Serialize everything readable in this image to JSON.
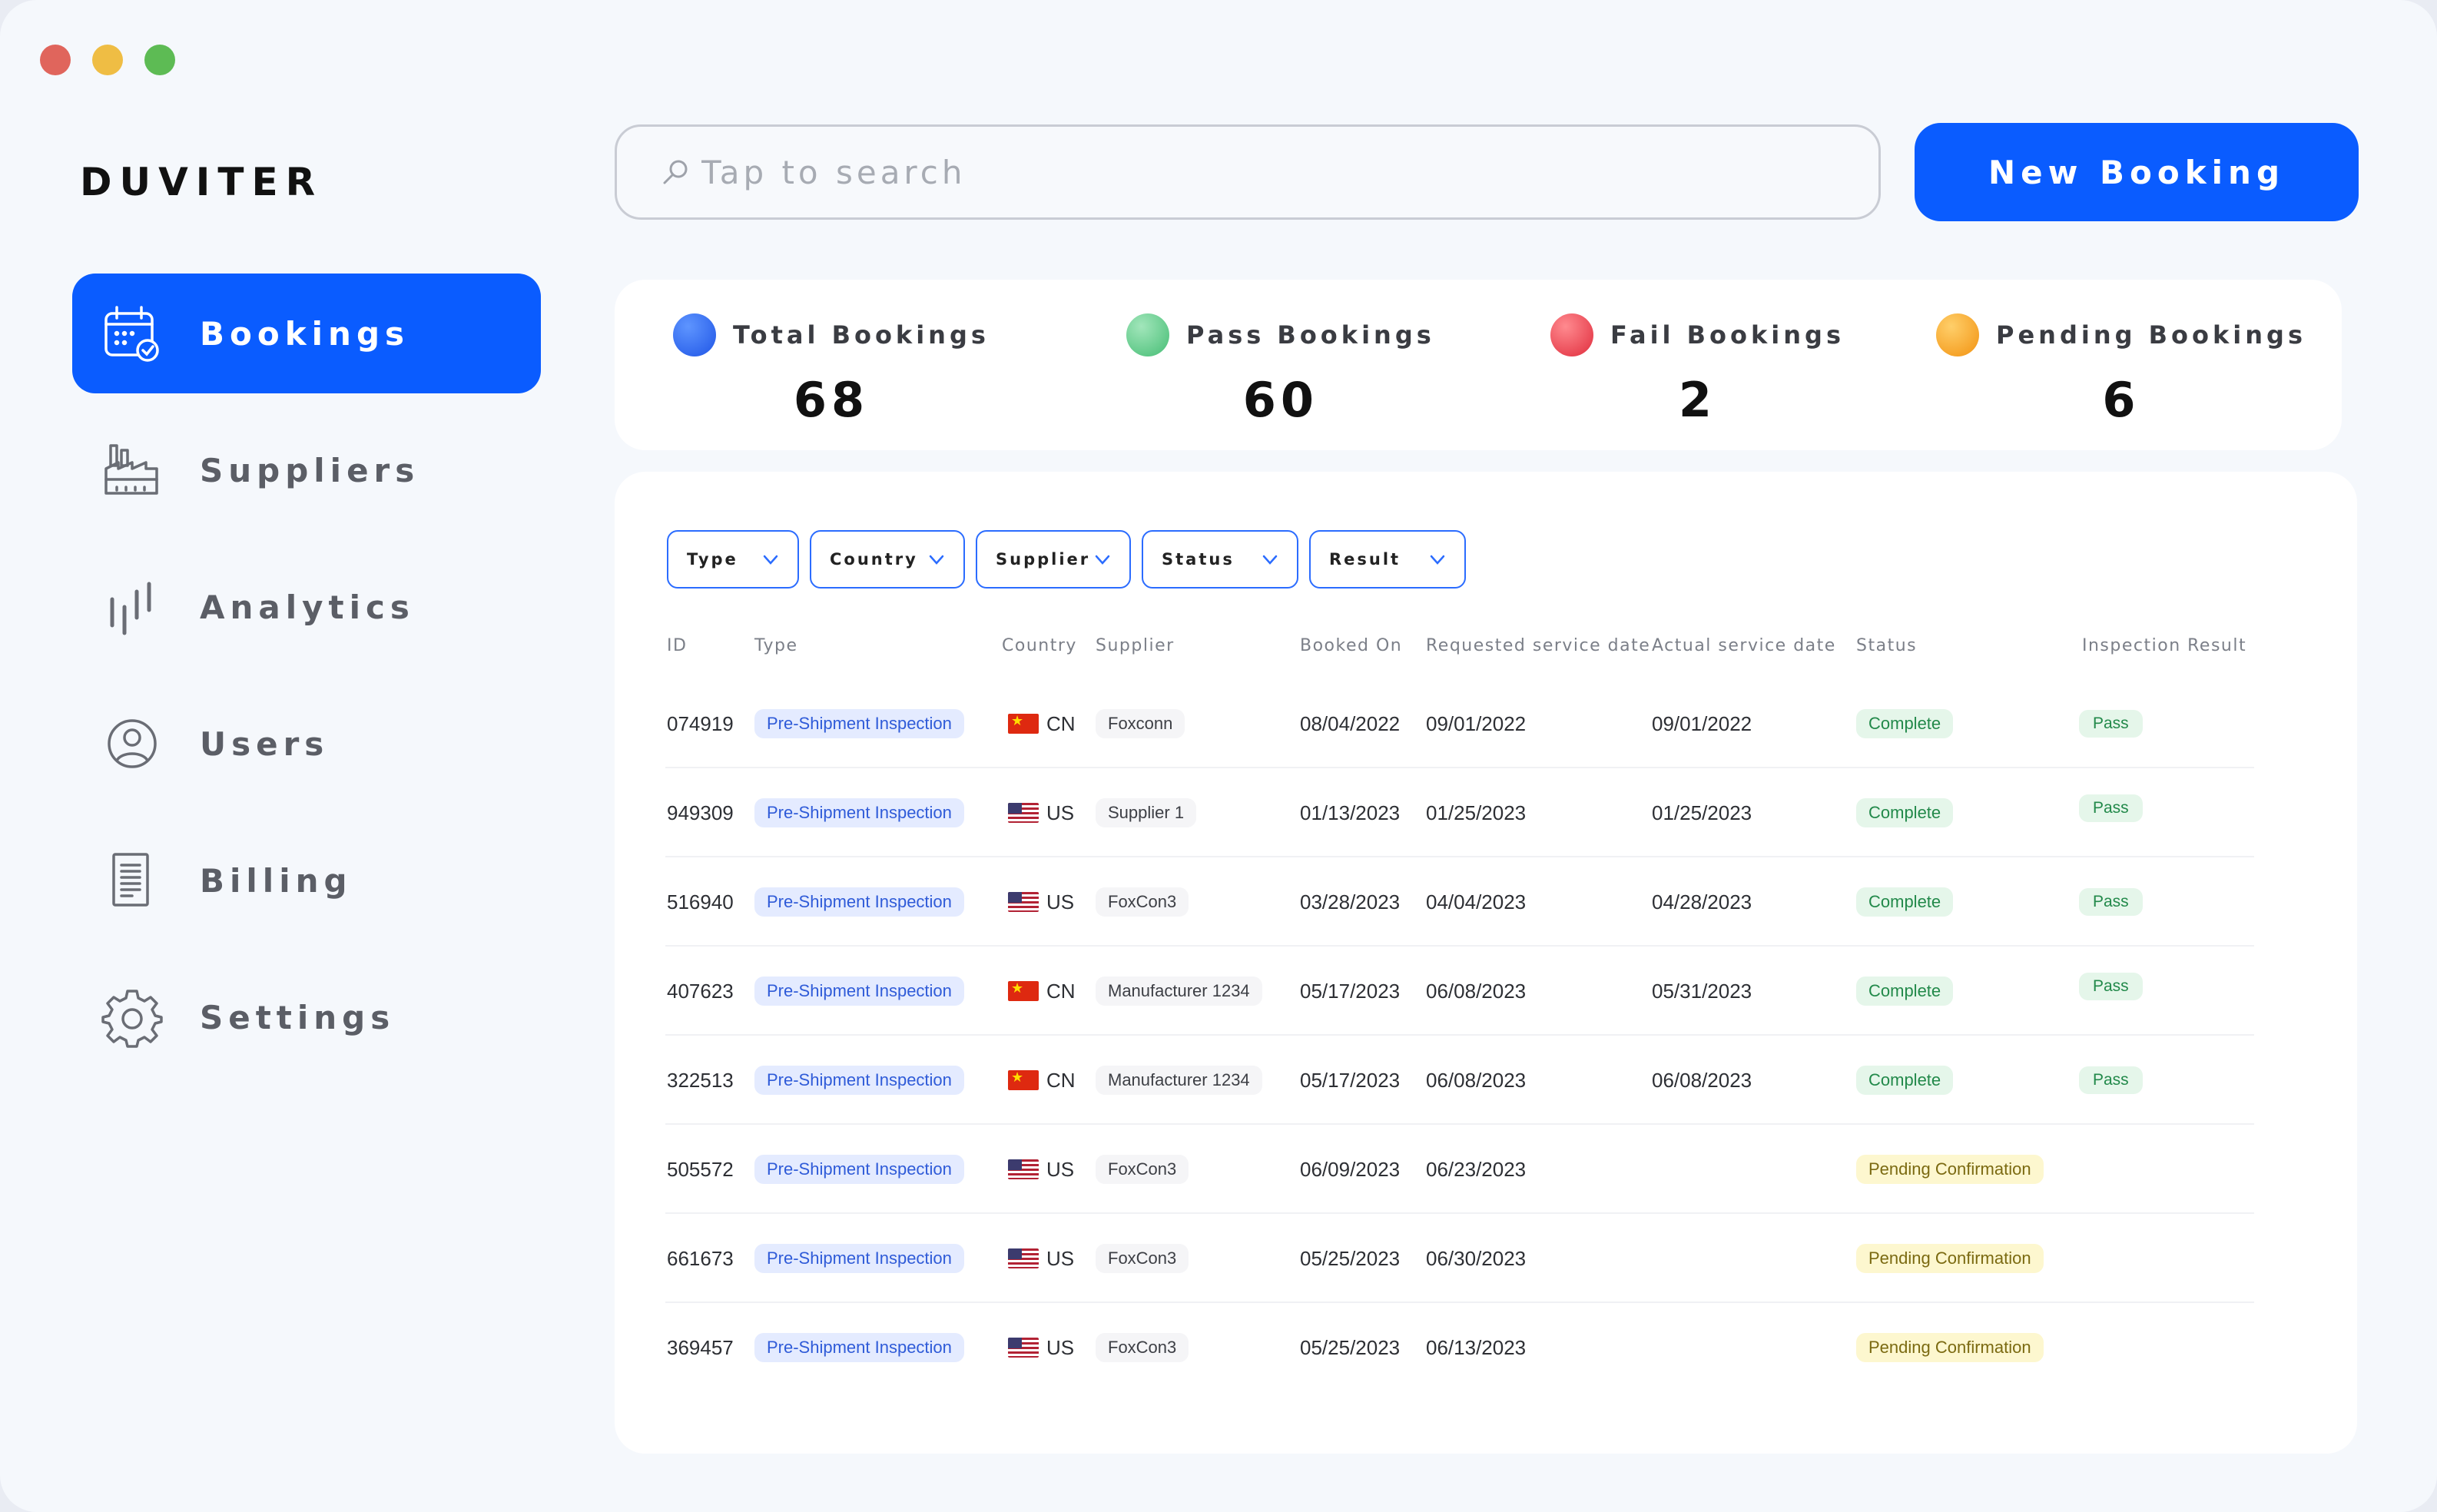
{
  "window": {
    "controls": [
      {
        "name": "close",
        "color": "#e0655c"
      },
      {
        "name": "minimize",
        "color": "#efbd44"
      },
      {
        "name": "maximize",
        "color": "#5dbb54"
      }
    ]
  },
  "brand": {
    "name": "DUVITER",
    "accent": "#0a5cff"
  },
  "sidebar": {
    "items": [
      {
        "label": "Bookings",
        "icon": "calendar-check-icon",
        "active": true
      },
      {
        "label": "Suppliers",
        "icon": "factory-icon",
        "active": false
      },
      {
        "label": "Analytics",
        "icon": "bar-chart-icon",
        "active": false
      },
      {
        "label": "Users",
        "icon": "user-circle-icon",
        "active": false
      },
      {
        "label": "Billing",
        "icon": "document-icon",
        "active": false
      },
      {
        "label": "Settings",
        "icon": "gear-icon",
        "active": false
      }
    ]
  },
  "search": {
    "placeholder": "Tap to search",
    "value": "",
    "icon": "search-icon"
  },
  "actions": {
    "new_booking_label": "New Booking"
  },
  "stats": [
    {
      "title": "Total Bookings",
      "value": "68",
      "color": "#1f66ff"
    },
    {
      "title": "Pass Bookings",
      "value": "60",
      "color": "#5dcb85"
    },
    {
      "title": "Fail Bookings",
      "value": "2",
      "color": "#e9404e"
    },
    {
      "title": "Pending Bookings",
      "value": "6",
      "color": "#f4a41b"
    }
  ],
  "filters": [
    "Type",
    "Country",
    "Supplier",
    "Status",
    "Result"
  ],
  "table": {
    "columns": [
      "ID",
      "Type",
      "Country",
      "Supplier",
      "Booked On",
      "Requested service date",
      "Actual service date",
      "Status",
      "Inspection Result"
    ],
    "rows": [
      {
        "id": "074919",
        "type": "Pre-Shipment Inspection",
        "country": "CN",
        "supplier": "Foxconn",
        "booked": "08/04/2022",
        "requested": "09/01/2022",
        "actual": "09/01/2022",
        "status": "Complete",
        "result": "Pass"
      },
      {
        "id": "949309",
        "type": "Pre-Shipment Inspection",
        "country": "US",
        "supplier": "Supplier 1",
        "booked": "01/13/2023",
        "requested": "01/25/2023",
        "actual": "01/25/2023",
        "status": "Complete",
        "result": "Pass"
      },
      {
        "id": "516940",
        "type": "Pre-Shipment Inspection",
        "country": "US",
        "supplier": "FoxCon3",
        "booked": "03/28/2023",
        "requested": "04/04/2023",
        "actual": "04/28/2023",
        "status": "Complete",
        "result": "Pass"
      },
      {
        "id": "407623",
        "type": "Pre-Shipment Inspection",
        "country": "CN",
        "supplier": "Manufacturer 1234",
        "booked": "05/17/2023",
        "requested": "06/08/2023",
        "actual": "05/31/2023",
        "status": "Complete",
        "result": "Pass"
      },
      {
        "id": "322513",
        "type": "Pre-Shipment Inspection",
        "country": "CN",
        "supplier": "Manufacturer 1234",
        "booked": "05/17/2023",
        "requested": "06/08/2023",
        "actual": "06/08/2023",
        "status": "Complete",
        "result": "Pass"
      },
      {
        "id": "505572",
        "type": "Pre-Shipment Inspection",
        "country": "US",
        "supplier": "FoxCon3",
        "booked": "06/09/2023",
        "requested": "06/23/2023",
        "actual": "",
        "status": "Pending Confirmation",
        "result": ""
      },
      {
        "id": "661673",
        "type": "Pre-Shipment Inspection",
        "country": "US",
        "supplier": "FoxCon3",
        "booked": "05/25/2023",
        "requested": "06/30/2023",
        "actual": "",
        "status": "Pending Confirmation",
        "result": ""
      },
      {
        "id": "369457",
        "type": "Pre-Shipment Inspection",
        "country": "US",
        "supplier": "FoxCon3",
        "booked": "05/25/2023",
        "requested": "06/13/2023",
        "actual": "",
        "status": "Pending Confirmation",
        "result": ""
      }
    ]
  }
}
